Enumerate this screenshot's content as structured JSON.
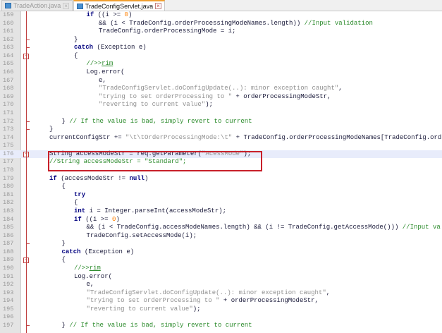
{
  "tabs": [
    {
      "label": "TradeAction.java",
      "active": false
    },
    {
      "label": "TradeConfigServlet.java",
      "active": true
    }
  ],
  "highlighted_line": 176,
  "fold_markers": [
    164,
    176,
    189
  ],
  "fold_ticks": [
    162,
    163,
    172,
    173,
    187,
    197
  ],
  "lines": [
    {
      "n": "159",
      "i": 3,
      "t": [
        [
          "kw",
          "if"
        ],
        [
          "pl",
          " ((i >= "
        ],
        [
          "num",
          "0"
        ],
        [
          "pl",
          ")"
        ]
      ]
    },
    {
      "n": "160",
      "i": 4,
      "t": [
        [
          "pl",
          "&& (i < TradeConfig.orderProcessingModeNames.length)) "
        ],
        [
          "com",
          "//Input validation"
        ]
      ]
    },
    {
      "n": "161",
      "i": 4,
      "t": [
        [
          "pl",
          "TradeConfig.orderProcessingMode = i;"
        ]
      ]
    },
    {
      "n": "162",
      "i": 2,
      "t": [
        [
          "pl",
          "}"
        ]
      ]
    },
    {
      "n": "163",
      "i": 2,
      "t": [
        [
          "kw",
          "catch"
        ],
        [
          "pl",
          " (Exception e)"
        ]
      ]
    },
    {
      "n": "164",
      "i": 2,
      "t": [
        [
          "pl",
          "{"
        ]
      ]
    },
    {
      "n": "165",
      "i": 3,
      "t": [
        [
          "com",
          "//>>"
        ],
        [
          "rim",
          "rim"
        ]
      ]
    },
    {
      "n": "166",
      "i": 3,
      "t": [
        [
          "pl",
          "Log.error("
        ]
      ]
    },
    {
      "n": "167",
      "i": 4,
      "t": [
        [
          "pl",
          "e,"
        ]
      ]
    },
    {
      "n": "168",
      "i": 4,
      "t": [
        [
          "str",
          "\"TradeConfigServlet.doConfigUpdate(..): minor exception caught\""
        ],
        [
          "pl",
          ","
        ]
      ]
    },
    {
      "n": "169",
      "i": 4,
      "t": [
        [
          "str",
          "\"trying to set orderProcessing to \""
        ],
        [
          "pl",
          " + orderProcessingModeStr,"
        ]
      ]
    },
    {
      "n": "170",
      "i": 4,
      "t": [
        [
          "str",
          "\"reverting to current value\""
        ],
        [
          "pl",
          ");"
        ]
      ]
    },
    {
      "n": "171",
      "i": 0,
      "t": []
    },
    {
      "n": "172",
      "i": 1,
      "t": [
        [
          "pl",
          "} "
        ],
        [
          "com",
          "// If the value is bad, simply revert to current"
        ]
      ]
    },
    {
      "n": "173",
      "i": 0,
      "t": [
        [
          "pl",
          "}"
        ]
      ]
    },
    {
      "n": "174",
      "i": 0,
      "t": [
        [
          "pl",
          "currentConfigStr += "
        ],
        [
          "str",
          "\"\\t\\tOrderProcessingMode:\\t\""
        ],
        [
          "pl",
          " + TradeConfig.orderProcessingModeNames[TradeConfig.orderP"
        ]
      ]
    },
    {
      "n": "175",
      "i": 0,
      "t": []
    },
    {
      "n": "176",
      "i": 0,
      "t": [
        [
          "pl",
          "String accessModeStr = req.getParameter("
        ],
        [
          "str",
          "\"AcessMode\""
        ],
        [
          "pl",
          ");"
        ]
      ]
    },
    {
      "n": "177",
      "i": 0,
      "t": [
        [
          "com",
          "//String accessModeStr = \"Standard\";"
        ]
      ]
    },
    {
      "n": "178",
      "i": 0,
      "t": []
    },
    {
      "n": "179",
      "i": 0,
      "t": [
        [
          "kw",
          "if"
        ],
        [
          "pl",
          " (accessModeStr != "
        ],
        [
          "kw",
          "null"
        ],
        [
          "pl",
          ")"
        ]
      ]
    },
    {
      "n": "180",
      "i": 1,
      "t": [
        [
          "pl",
          "{"
        ]
      ]
    },
    {
      "n": "181",
      "i": 2,
      "t": [
        [
          "kw",
          "try"
        ]
      ]
    },
    {
      "n": "182",
      "i": 2,
      "t": [
        [
          "pl",
          "{"
        ]
      ]
    },
    {
      "n": "183",
      "i": 2,
      "t": [
        [
          "kw",
          "int"
        ],
        [
          "pl",
          " i = Integer.parseInt(accessModeStr);"
        ]
      ]
    },
    {
      "n": "184",
      "i": 2,
      "t": [
        [
          "kw",
          "if"
        ],
        [
          "pl",
          " ((i >= "
        ],
        [
          "num",
          "0"
        ],
        [
          "pl",
          ")"
        ]
      ]
    },
    {
      "n": "185",
      "i": 3,
      "t": [
        [
          "pl",
          "&& (i < TradeConfig.accessModeNames.length) && (i != TradeConfig.getAccessMode())) "
        ],
        [
          "com",
          "//Input va"
        ]
      ]
    },
    {
      "n": "186",
      "i": 3,
      "t": [
        [
          "pl",
          "TradeConfig.setAccessMode(i);"
        ]
      ]
    },
    {
      "n": "187",
      "i": 1,
      "t": [
        [
          "pl",
          "}"
        ]
      ]
    },
    {
      "n": "188",
      "i": 1,
      "t": [
        [
          "kw",
          "catch"
        ],
        [
          "pl",
          " (Exception e)"
        ]
      ]
    },
    {
      "n": "189",
      "i": 1,
      "t": [
        [
          "pl",
          "{"
        ]
      ]
    },
    {
      "n": "190",
      "i": 2,
      "t": [
        [
          "com",
          "//>>"
        ],
        [
          "rim",
          "rim"
        ]
      ]
    },
    {
      "n": "191",
      "i": 2,
      "t": [
        [
          "pl",
          "Log.error("
        ]
      ]
    },
    {
      "n": "192",
      "i": 3,
      "t": [
        [
          "pl",
          "e,"
        ]
      ]
    },
    {
      "n": "193",
      "i": 3,
      "t": [
        [
          "str",
          "\"TradeConfigServlet.doConfigUpdate(..): minor exception caught\""
        ],
        [
          "pl",
          ","
        ]
      ]
    },
    {
      "n": "194",
      "i": 3,
      "t": [
        [
          "str",
          "\"trying to set orderProcessing to \""
        ],
        [
          "pl",
          " + orderProcessingModeStr,"
        ]
      ]
    },
    {
      "n": "195",
      "i": 3,
      "t": [
        [
          "str",
          "\"reverting to current value\""
        ],
        [
          "pl",
          ");"
        ]
      ]
    },
    {
      "n": "196",
      "i": 0,
      "t": []
    },
    {
      "n": "197",
      "i": 1,
      "t": [
        [
          "pl",
          "} "
        ],
        [
          "com",
          "// If the value is bad, simply revert to current"
        ]
      ]
    }
  ]
}
